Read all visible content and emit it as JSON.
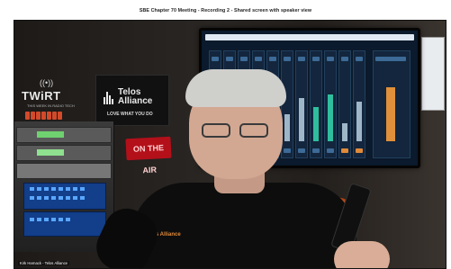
{
  "window": {
    "title": "SBE Chapter 70 Meeting - Recording 2 - Shared screen with speaker view"
  },
  "video": {
    "speaker_label": "Kirk Harnack - Telos Alliance",
    "background_signs": {
      "twirt_logo": "TWiRT",
      "twirt_sub": "THIS WEEK IN RADIO TECH",
      "telos_name": "Telos Alliance",
      "telos_tagline": "LOVE WHAT YOU DO",
      "on_air": "ON THE AIR",
      "shirt_logo": "Telos Alliance"
    }
  },
  "colors": {
    "on_air_red": "#b3101a",
    "shirt_logo_orange": "#e08a3a"
  }
}
